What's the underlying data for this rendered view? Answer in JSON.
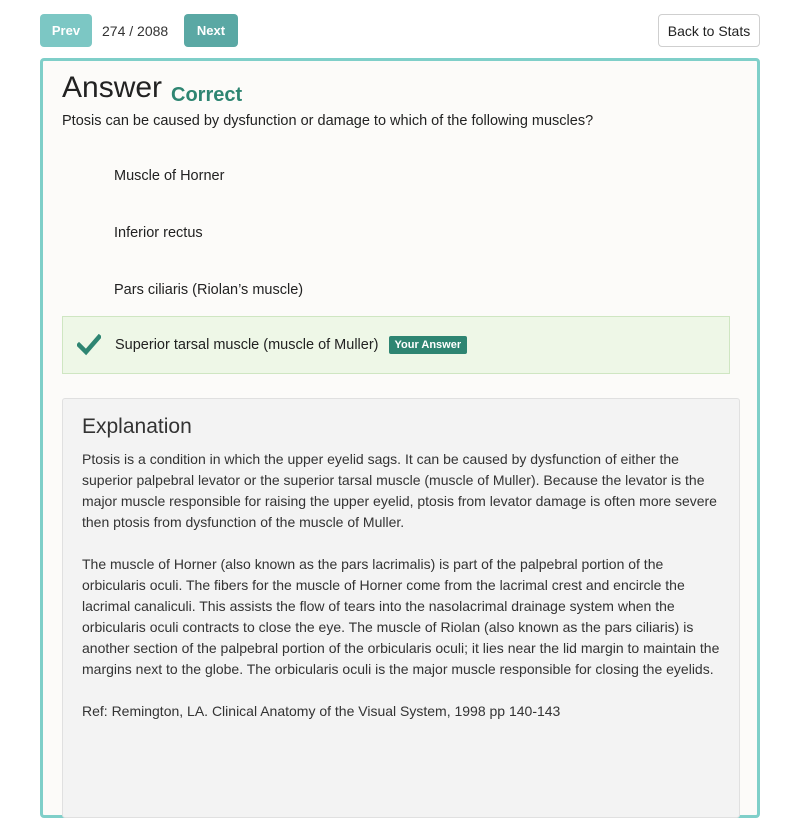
{
  "nav": {
    "prev_label": "Prev",
    "counter": "274 / 2088",
    "next_label": "Next",
    "back_label": "Back to Stats"
  },
  "card": {
    "heading": "Answer",
    "result": "Correct",
    "question": "Ptosis can be caused by dysfunction or damage to which of the following muscles?",
    "options": [
      {
        "label": "Muscle of Horner",
        "selected": false
      },
      {
        "label": "Inferior rectus",
        "selected": false
      },
      {
        "label": "Pars ciliaris (Riolan’s muscle)",
        "selected": false
      },
      {
        "label": "Superior tarsal muscle (muscle of Muller)",
        "selected": true,
        "badge": "Your Answer"
      }
    ]
  },
  "explanation": {
    "title": "Explanation",
    "paragraphs": [
      "Ptosis is a condition in which the upper eyelid sags. It can be caused by dysfunction of either the superior palpebral levator or the superior tarsal muscle (muscle of Muller). Because the levator is the major muscle responsible for raising the upper eyelid, ptosis from levator damage is often more severe then ptosis from dysfunction of the muscle of Muller.",
      "The muscle of Horner (also known as the pars lacrimalis) is part of the palpebral portion of the orbicularis oculi. The fibers for the muscle of Horner come from the lacrimal crest and encircle the lacrimal canaliculi. This assists the flow of tears into the nasolacrimal drainage system when the orbicularis oculi contracts to close the eye. The muscle of Riolan (also known as the pars ciliaris) is another section of the palpebral portion of the orbicularis oculi; it lies near the lid margin to maintain the margins next to the globe. The orbicularis oculi is the major muscle responsible for closing the eyelids.",
      "Ref: Remington, LA. Clinical Anatomy of the Visual System, 1998 pp 140-143"
    ]
  },
  "colors": {
    "accent": "#2e8572",
    "card_border": "#7fcfc9",
    "selected_bg": "#eef7e7"
  },
  "icons": {
    "selected_marker": "check-icon"
  }
}
